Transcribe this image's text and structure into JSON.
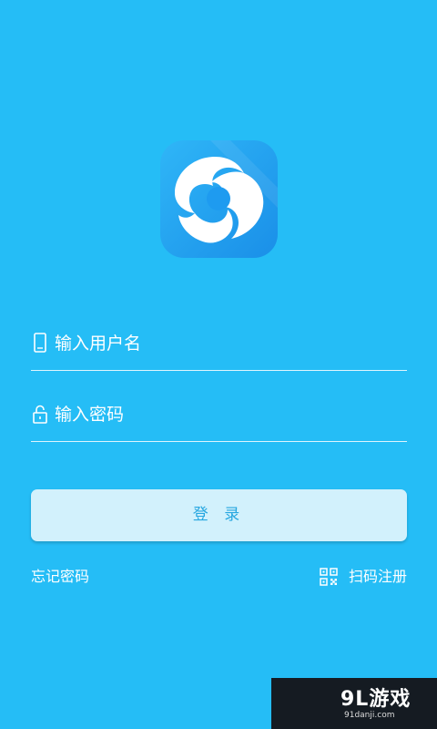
{
  "login": {
    "username_placeholder": "输入用户名",
    "password_placeholder": "输入密码",
    "login_button_label": "登 录",
    "forgot_password_label": "忘记密码",
    "scan_register_label": "扫码注册"
  },
  "watermark": {
    "brand_text": "9L游戏",
    "site_text": "91danji.com"
  },
  "icons": {
    "app_logo": "app-logo-icon",
    "username": "phone-icon",
    "password": "lock-icon",
    "scan": "qr-code-icon"
  },
  "colors": {
    "background": "#25bdf6",
    "button_bg": "#d2f1fc",
    "button_text": "#27a7e0",
    "logo_bg": "#1e9bf0"
  }
}
